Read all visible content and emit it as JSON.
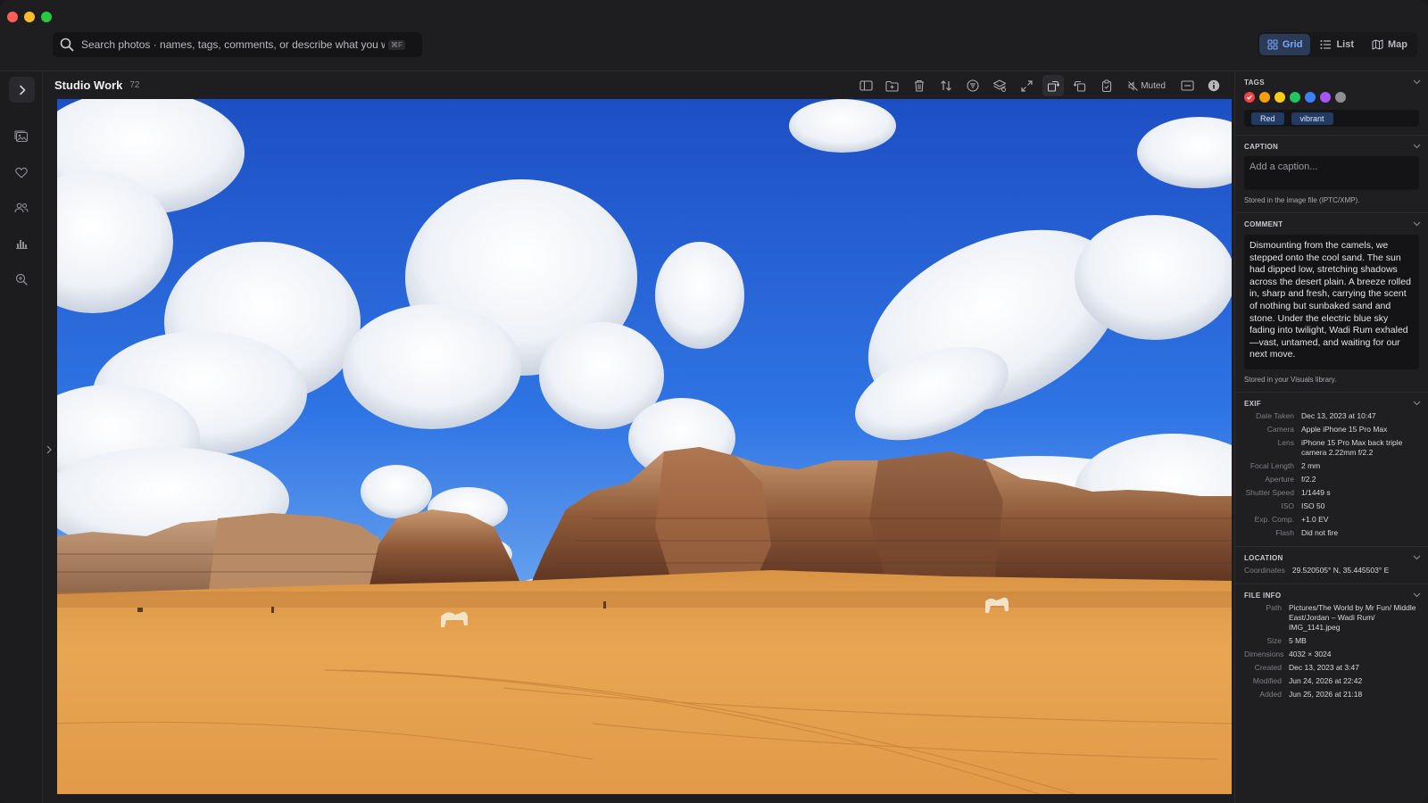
{
  "search": {
    "placeholder": "Search photos · names, tags, comments, or describe what you want",
    "shortcut": "⌘F"
  },
  "views": [
    {
      "label": "Grid",
      "icon": "grid-icon",
      "active": true
    },
    {
      "label": "List",
      "icon": "list-icon",
      "active": false
    },
    {
      "label": "Map",
      "icon": "map-icon",
      "active": false
    }
  ],
  "sidebar": {
    "icons": [
      "photos-icon",
      "heart-icon",
      "people-icon",
      "chart-icon",
      "zoom-search-icon"
    ]
  },
  "album": {
    "title": "Studio Work",
    "count": "72"
  },
  "toolbar": {
    "muted_label": "Muted",
    "icons": [
      "sidebar-toggle-icon",
      "folder-add-icon",
      "trash-icon",
      "sort-icon",
      "filter-icon",
      "layers-icon",
      "expand-icon",
      "rotate-right-icon",
      "rotate-left-icon",
      "clipboard-icon",
      "speaker-muted-icon",
      "minimize-icon",
      "info-icon"
    ]
  },
  "inspector": {
    "tags": {
      "title": "TAGS",
      "colors": [
        "#ef4444",
        "#f59e0b",
        "#facc15",
        "#22c55e",
        "#3b82f6",
        "#a855f7",
        "#8e8e93"
      ],
      "chips": [
        "Red",
        "vibrant"
      ]
    },
    "caption": {
      "title": "CAPTION",
      "placeholder": "Add a caption...",
      "note": "Stored in the image file (IPTC/XMP)."
    },
    "comment": {
      "title": "COMMENT",
      "text": "Dismounting from the camels, we stepped onto the cool sand. The sun had dipped low, stretching shadows across the desert plain. A breeze rolled in, sharp and fresh, carrying the scent of nothing but sunbaked sand and stone. Under the electric blue sky fading into twilight, Wadi Rum exhaled—vast, untamed, and waiting for our next move.",
      "note": "Stored in your Visuals library."
    },
    "exif": {
      "title": "EXIF",
      "rows": [
        {
          "k": "Date Taken",
          "v": "Dec 13, 2023 at 10:47"
        },
        {
          "k": "Camera",
          "v": "Apple iPhone 15 Pro Max"
        },
        {
          "k": "Lens",
          "v": "iPhone 15 Pro Max back triple camera 2.22mm f/2.2"
        },
        {
          "k": "Focal Length",
          "v": "2 mm"
        },
        {
          "k": "Aperture",
          "v": "f/2.2"
        },
        {
          "k": "Shutter Speed",
          "v": "1/1449 s"
        },
        {
          "k": "ISO",
          "v": "ISO 50"
        },
        {
          "k": "Exp. Comp.",
          "v": "+1.0 EV"
        },
        {
          "k": "Flash",
          "v": "Did not fire"
        }
      ]
    },
    "location": {
      "title": "LOCATION",
      "k": "Coordinates",
      "v": "29.520505° N, 35.445503° E"
    },
    "file_info": {
      "title": "FILE INFO",
      "rows": [
        {
          "k": "Path",
          "v": "Pictures/The World by Mr Fun/ Middle East/Jordan – Wadi Rum/ IMG_1141.jpeg"
        },
        {
          "k": "Size",
          "v": "5 MB"
        },
        {
          "k": "Dimensions",
          "v": "4032 × 3024"
        },
        {
          "k": "Created",
          "v": "Dec 13, 2023 at 3:47"
        },
        {
          "k": "Modified",
          "v": "Jun 24, 2026 at 22:42"
        },
        {
          "k": "Added",
          "v": "Jun 25, 2026 at 21:18"
        }
      ]
    }
  }
}
